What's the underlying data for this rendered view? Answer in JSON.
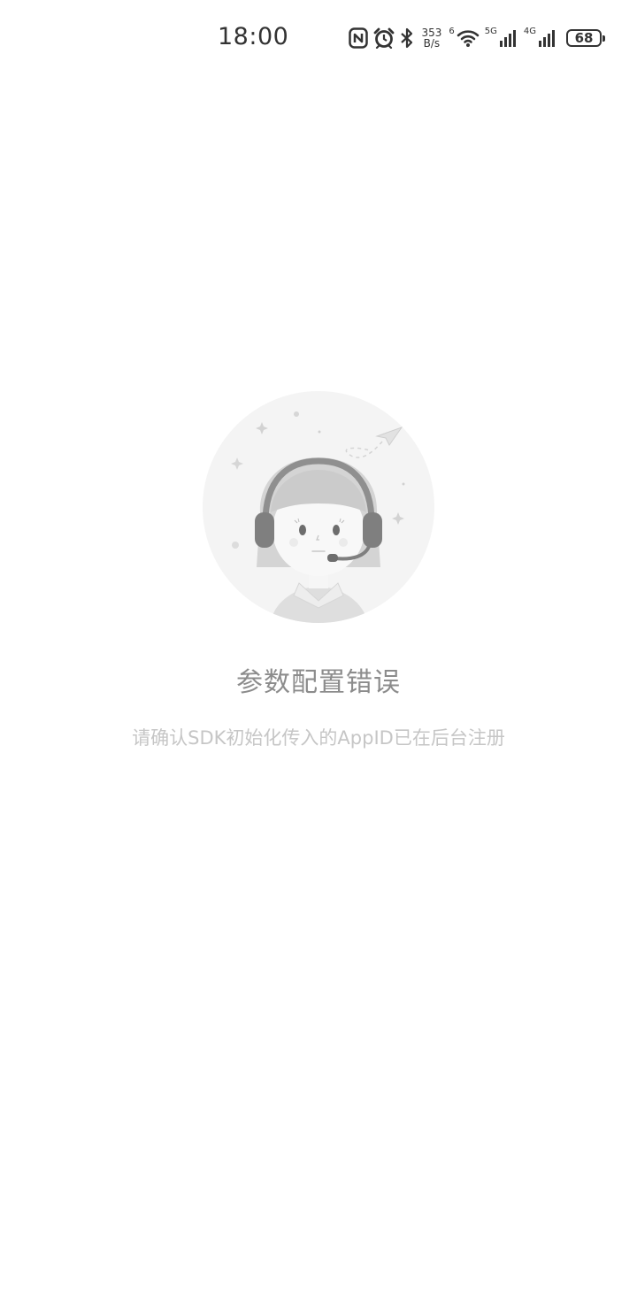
{
  "status_bar": {
    "time": "18:00",
    "net_speed_value": "353",
    "net_speed_unit": "B/s",
    "wifi_label": "6",
    "signal1_label": "5G",
    "signal2_label": "4G",
    "battery_level": "68",
    "icons": [
      "nfc-icon",
      "alarm-icon",
      "bluetooth-icon",
      "wifi-icon",
      "signal-icon",
      "battery-icon"
    ]
  },
  "error": {
    "illustration": "customer-service-girl-with-headset",
    "title": "参数配置错误",
    "description": "请确认SDK初始化传入的AppID已在后台注册"
  }
}
